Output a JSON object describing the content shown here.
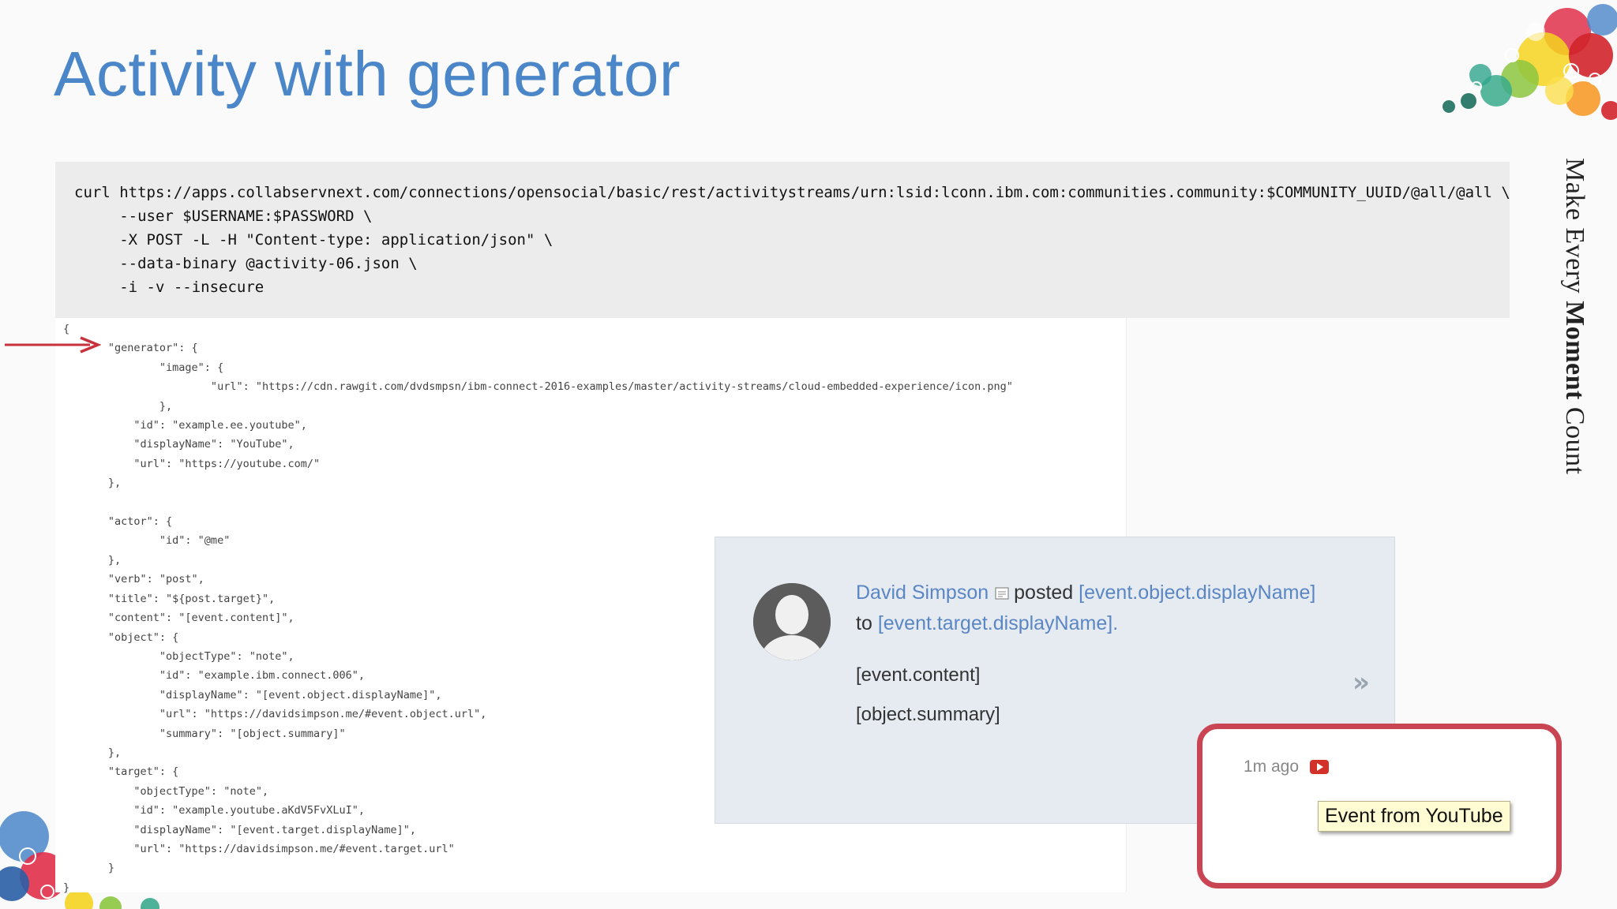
{
  "slide": {
    "title": "Activity with generator",
    "side_text_pre": "Make Every ",
    "side_text_bold": "Moment",
    "side_text_post": " Count"
  },
  "curl_command": "curl https://apps.collabservnext.com/connections/opensocial/basic/rest/activitystreams/urn:lsid:lconn.ibm.com:communities.community:$COMMUNITY_UUID/@all/@all \\\n     --user $USERNAME:$PASSWORD \\\n     -X POST -L -H \"Content-type: application/json\" \\\n     --data-binary @activity-06.json \\\n     -i -v --insecure",
  "json_body": "{\n       \"generator\": {\n               \"image\": {\n                       \"url\": \"https://cdn.rawgit.com/dvdsmpsn/ibm-connect-2016-examples/master/activity-streams/cloud-embedded-experience/icon.png\"\n               },\n           \"id\": \"example.ee.youtube\",\n           \"displayName\": \"YouTube\",\n           \"url\": \"https://youtube.com/\"\n       },\n\n       \"actor\": {\n               \"id\": \"@me\"\n       },\n       \"verb\": \"post\",\n       \"title\": \"${post.target}\",\n       \"content\": \"[event.content]\",\n       \"object\": {\n               \"objectType\": \"note\",\n               \"id\": \"example.ibm.connect.006\",\n               \"displayName\": \"[event.object.displayName]\",\n               \"url\": \"https://davidsimpson.me/#event.object.url\",\n               \"summary\": \"[object.summary]\"\n       },\n       \"target\": {\n           \"objectType\": \"note\",\n           \"id\": \"example.youtube.aKdV5FvXLuI\",\n           \"displayName\": \"[event.target.displayName]\",\n           \"url\": \"https://davidsimpson.me/#event.target.url\"\n       }\n}",
  "card": {
    "author": "David Simpson",
    "posted": "posted",
    "object_link": "[event.object.displayName]",
    "to": "to",
    "target_link": "[event.target.displayName].",
    "content": "[event.content]",
    "summary": "[object.summary]",
    "more": "»",
    "time_ago": "1m ago",
    "tooltip": "Event from YouTube"
  },
  "colors": {
    "title": "#4a86c8",
    "link": "#5a86c4",
    "highlight": "#c94553",
    "arrow": "#c8323c",
    "youtube": "#d4302a"
  },
  "icons": [
    "arrow-right-icon",
    "document-icon",
    "youtube-icon",
    "chevron-double-right-icon",
    "avatar-placeholder-icon"
  ]
}
